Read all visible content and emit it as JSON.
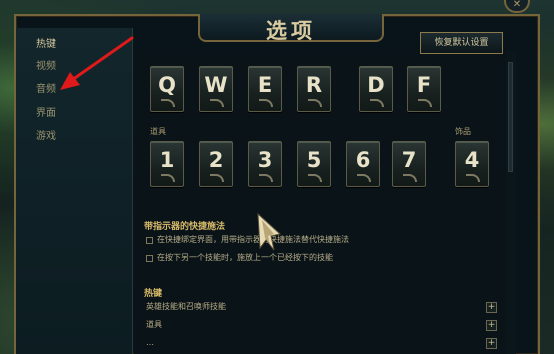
{
  "window": {
    "title": "选项",
    "close_glyph": "✕"
  },
  "sidebar": {
    "items": [
      {
        "label": "热键",
        "active": true
      },
      {
        "label": "视频",
        "active": false
      },
      {
        "label": "音频",
        "active": false
      },
      {
        "label": "界面",
        "active": false
      },
      {
        "label": "游戏",
        "active": false
      }
    ]
  },
  "toolbar": {
    "reset_label": "恢复默认设置"
  },
  "abilities": {
    "keys": [
      {
        "label": "Q"
      },
      {
        "label": "W"
      },
      {
        "label": "E"
      },
      {
        "label": "R"
      },
      {
        "label": "D"
      },
      {
        "label": "F"
      }
    ]
  },
  "items": {
    "label": "道具",
    "keys": [
      {
        "label": "1"
      },
      {
        "label": "2"
      },
      {
        "label": "3"
      },
      {
        "label": "5"
      },
      {
        "label": "6"
      },
      {
        "label": "7"
      }
    ]
  },
  "trinket": {
    "label": "饰品",
    "key": "4"
  },
  "quickcast": {
    "title": "带指示器的快捷施法",
    "options": [
      {
        "label": "在快捷绑定界面，用带指示器的快捷施法替代快捷施法",
        "checked": false
      },
      {
        "label": "在按下另一个技能时，施放上一个已经按下的技能",
        "checked": false
      }
    ]
  },
  "hotkeys": {
    "title": "热键",
    "rows": [
      {
        "label": "英雄技能和召唤师技能",
        "expand": "+"
      },
      {
        "label": "道具",
        "expand": "+"
      },
      {
        "label": "…",
        "expand": "+"
      }
    ]
  },
  "colors": {
    "gold_border": "#76643a",
    "accent_gold": "#d7bb6a",
    "arrow_red": "#e01a1a"
  }
}
